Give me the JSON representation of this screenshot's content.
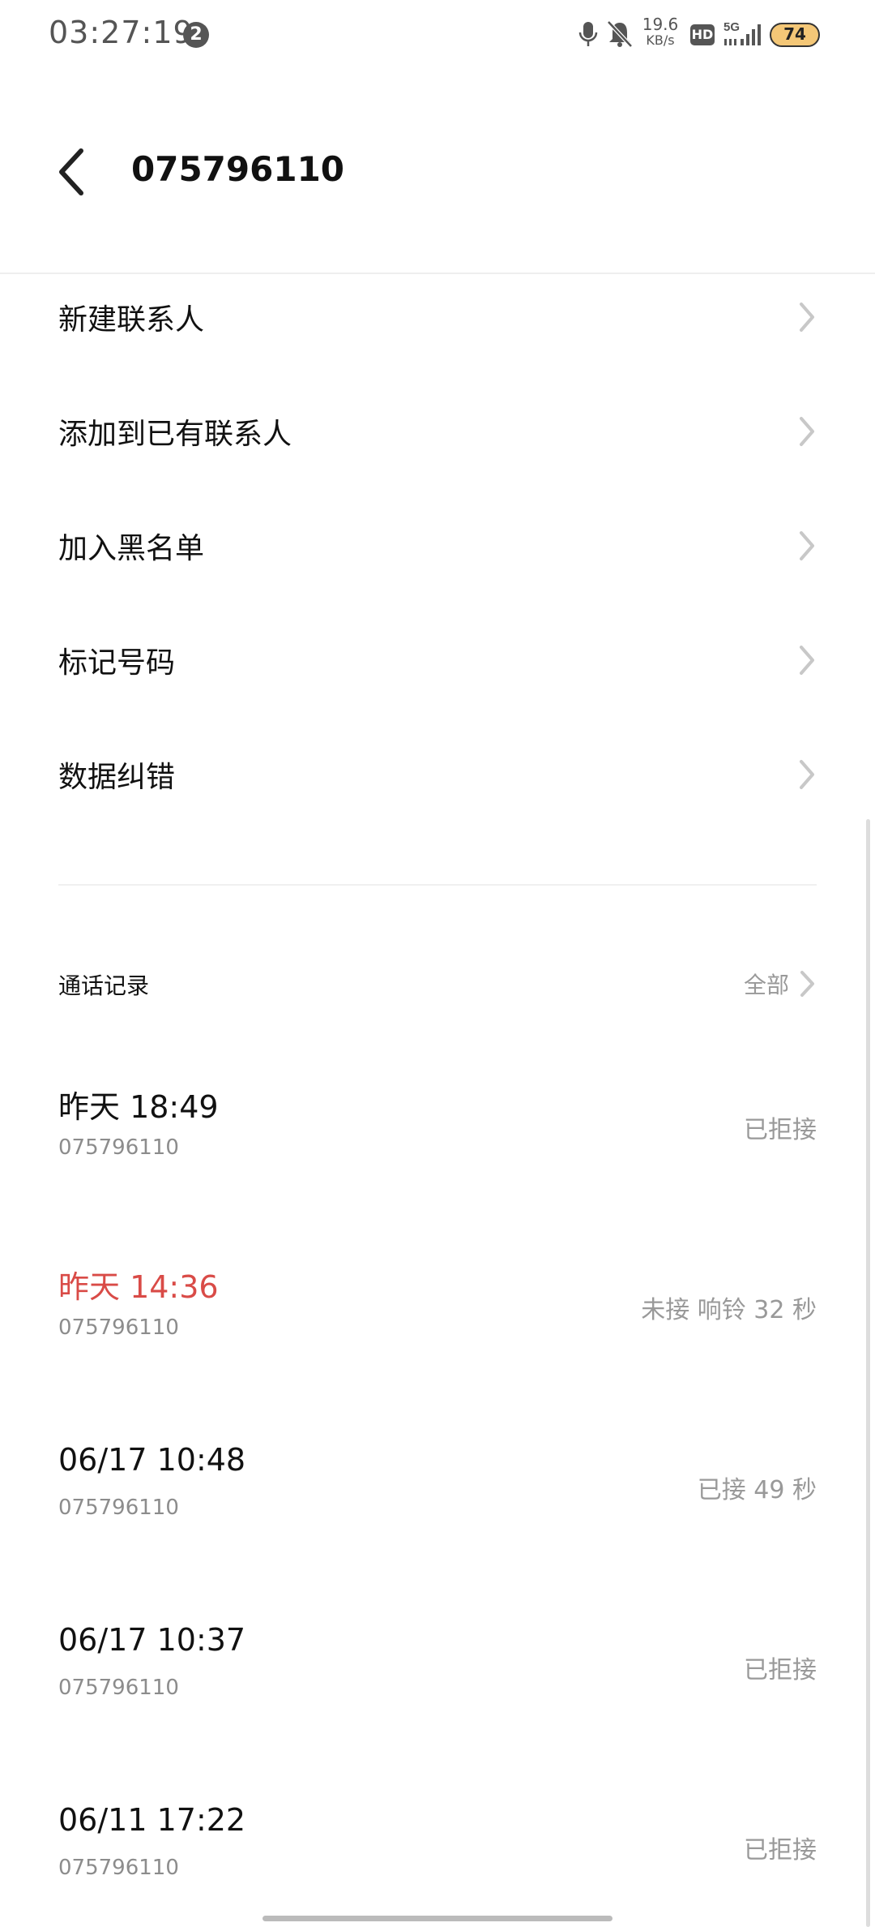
{
  "status_bar": {
    "time": "03:27:19",
    "notification_count": "2",
    "net_speed_value": "19.6",
    "net_speed_unit": "KB/s",
    "hd_label": "HD",
    "network_label": "5G",
    "battery_level": "74"
  },
  "header": {
    "title": "075796110"
  },
  "menu": {
    "items": [
      {
        "label": "新建联系人"
      },
      {
        "label": "添加到已有联系人"
      },
      {
        "label": "加入黑名单"
      },
      {
        "label": "标记号码"
      },
      {
        "label": "数据纠错"
      }
    ]
  },
  "call_log": {
    "title": "通话记录",
    "all_label": "全部",
    "entries": [
      {
        "time": "昨天 18:49",
        "number": "075796110",
        "status": "已拒接",
        "missed": false
      },
      {
        "time": "昨天 14:36",
        "number": "075796110",
        "status": "未接 响铃 32 秒",
        "missed": true
      },
      {
        "time": "06/17 10:48",
        "number": "075796110",
        "status": "已接 49 秒",
        "missed": false
      },
      {
        "time": "06/17 10:37",
        "number": "075796110",
        "status": "已拒接",
        "missed": false
      },
      {
        "time": "06/11 17:22",
        "number": "075796110",
        "status": "已拒接",
        "missed": false
      }
    ]
  },
  "colors": {
    "missed": "#d94b47",
    "secondary_text": "#999999",
    "battery_fill": "#f4c777"
  }
}
